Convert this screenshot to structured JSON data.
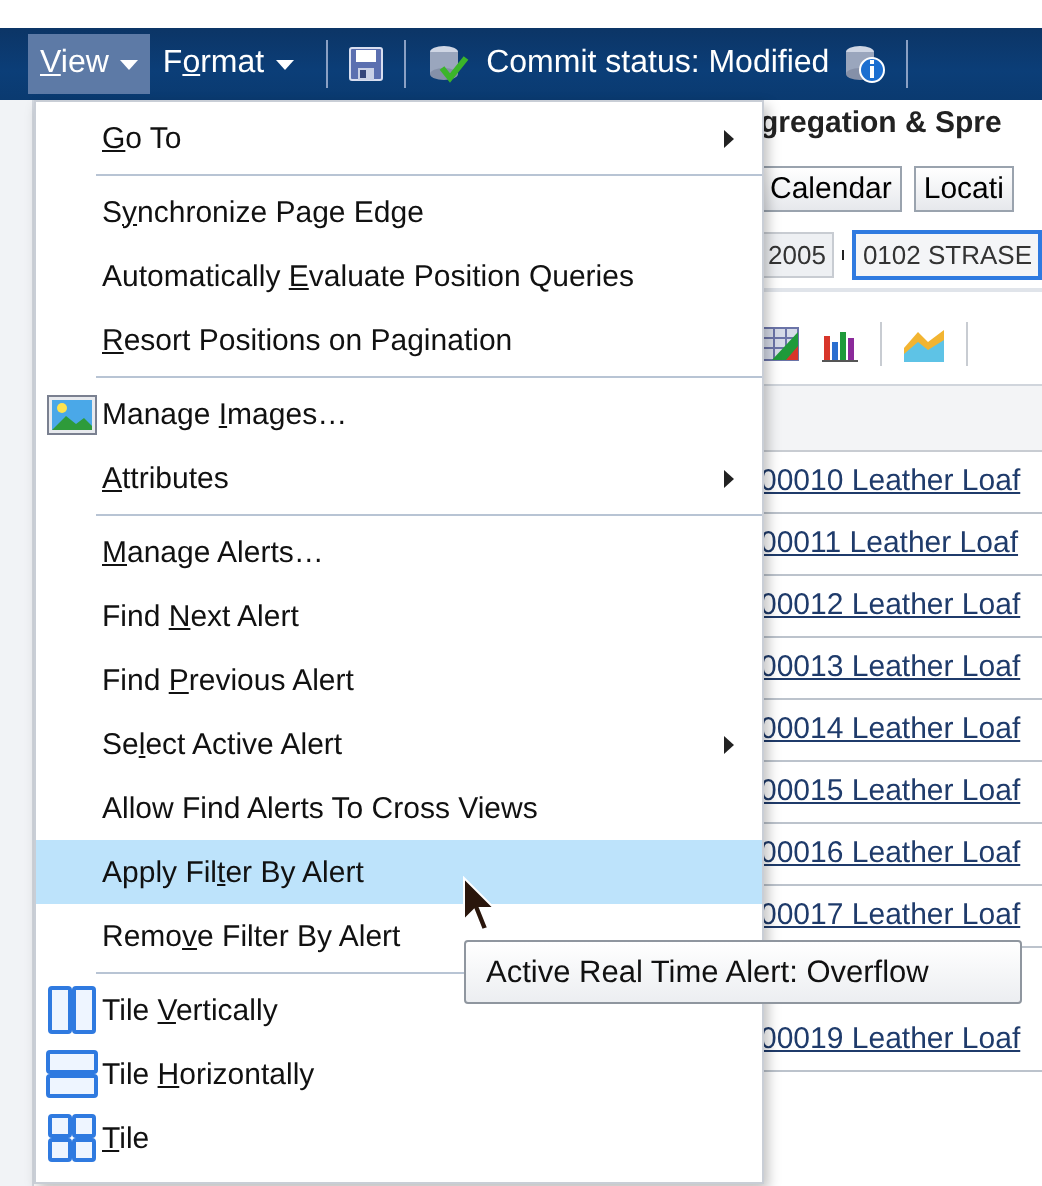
{
  "toolbar": {
    "menus": [
      {
        "label": {
          "key": "V",
          "after": "iew"
        },
        "selected": true
      },
      {
        "label": {
          "before": "F",
          "key": "o",
          "after": "rmat"
        },
        "selected": false
      }
    ],
    "commit_status": "Commit status: Modified"
  },
  "background": {
    "title": "gregation & Spre",
    "buttons": [
      "Calendar",
      "Locati"
    ],
    "breadcrumb": [
      "2005",
      "0102 STRASE"
    ],
    "rows": [
      "00010 Leather Loaf",
      "00011 Leather Loaf",
      "00012 Leather Loaf",
      "00013 Leather Loaf",
      "00014 Leather Loaf",
      "00015 Leather Loaf",
      "00016 Leather Loaf",
      "00017 Leather Loaf",
      "00019 Leather Loaf"
    ]
  },
  "menu": {
    "items": [
      {
        "kind": "item",
        "label": {
          "key": "G",
          "after": "o To"
        },
        "submenu": true,
        "selected": false
      },
      {
        "kind": "separator"
      },
      {
        "kind": "item",
        "label": {
          "before": "S",
          "key": "y",
          "after": "nchronize Page Edge"
        },
        "submenu": false,
        "selected": false
      },
      {
        "kind": "item",
        "label": {
          "before": "Automatically ",
          "key": "E",
          "after": "valuate Position Queries"
        },
        "submenu": false,
        "selected": false
      },
      {
        "kind": "item",
        "label": {
          "key": "R",
          "after": "esort Positions on Pagination"
        },
        "submenu": false,
        "selected": false
      },
      {
        "kind": "separator"
      },
      {
        "kind": "images",
        "label": {
          "before": "Manage ",
          "key": "I",
          "after": "mages…"
        },
        "submenu": false,
        "selected": false
      },
      {
        "kind": "item",
        "label": {
          "key": "A",
          "after": "ttributes"
        },
        "submenu": true,
        "selected": false
      },
      {
        "kind": "separator"
      },
      {
        "kind": "item",
        "label": {
          "key": "M",
          "after": "anage Alerts…"
        },
        "submenu": false,
        "selected": false
      },
      {
        "kind": "item",
        "label": {
          "before": "Find ",
          "key": "N",
          "after": "ext Alert"
        },
        "submenu": false,
        "selected": false
      },
      {
        "kind": "item",
        "label": {
          "before": "Find ",
          "key": "P",
          "after": "revious Alert"
        },
        "submenu": false,
        "selected": false
      },
      {
        "kind": "item",
        "label": {
          "before": "Se",
          "key": "l",
          "after": "ect Active Alert"
        },
        "submenu": true,
        "selected": false
      },
      {
        "kind": "item",
        "label": {
          "before": "Allow Find Alerts To Cross Views"
        },
        "submenu": false,
        "selected": false
      },
      {
        "kind": "item",
        "label": {
          "before": "Apply Fil",
          "key": "t",
          "after": "er By Alert"
        },
        "submenu": false,
        "selected": true
      },
      {
        "kind": "item",
        "label": {
          "before": "Remo",
          "key": "v",
          "after": "e Filter By Alert"
        },
        "submenu": false,
        "selected": false
      },
      {
        "kind": "separator"
      },
      {
        "kind": "tile-vertical",
        "label": {
          "before": "Tile ",
          "key": "V",
          "after": "ertically"
        },
        "submenu": false,
        "selected": false
      },
      {
        "kind": "tile-horizontal",
        "label": {
          "before": "Tile ",
          "key": "H",
          "after": "orizontally"
        },
        "submenu": false,
        "selected": false
      },
      {
        "kind": "tile",
        "label": {
          "key": "T",
          "after": "ile"
        },
        "submenu": false,
        "selected": false
      }
    ]
  },
  "tooltip": "Active Real Time Alert: Overflow"
}
